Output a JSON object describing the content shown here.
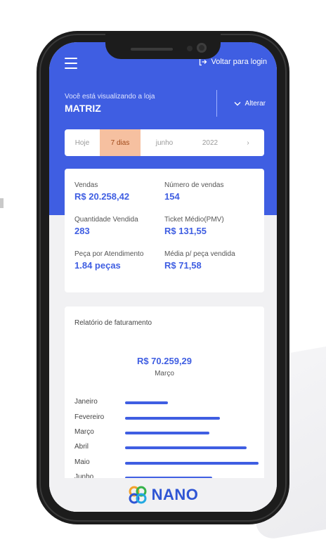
{
  "topbar": {
    "back_label": "Voltar para login"
  },
  "store": {
    "caption": "Você está visualizando a loja",
    "name": "MATRIZ",
    "change_label": "Alterar"
  },
  "filter": {
    "segments": [
      "Hoje",
      "7 dias",
      "junho",
      "2022",
      "›"
    ],
    "active_index": 1
  },
  "kpis": [
    {
      "label": "Vendas",
      "value": "R$ 20.258,42"
    },
    {
      "label": "Número de vendas",
      "value": "154"
    },
    {
      "label": "Quantidade Vendida",
      "value": "283"
    },
    {
      "label": "Ticket Médio(PMV)",
      "value": "R$ 131,55"
    },
    {
      "label": "Peça por Atendimento",
      "value": "1.84 peças"
    },
    {
      "label": "Média p/ peça vendida",
      "value": "R$ 71,58"
    }
  ],
  "report": {
    "title": "Relatório de faturamento",
    "highlight_value": "R$ 70.259,29",
    "highlight_month": "Março",
    "months": [
      {
        "label": "Janeiro",
        "level": 0.32
      },
      {
        "label": "Fevereiro",
        "level": 0.71
      },
      {
        "label": "Março",
        "level": 0.63
      },
      {
        "label": "Abril",
        "level": 0.91
      },
      {
        "label": "Maio",
        "level": 1.0
      },
      {
        "label": "Junho",
        "level": 0.65
      }
    ]
  },
  "brand": {
    "logo_text": "NANO"
  },
  "colors": {
    "primary": "#3f5ee2",
    "active_filter": "#f6c0a0",
    "logo": "#2f55d4"
  }
}
